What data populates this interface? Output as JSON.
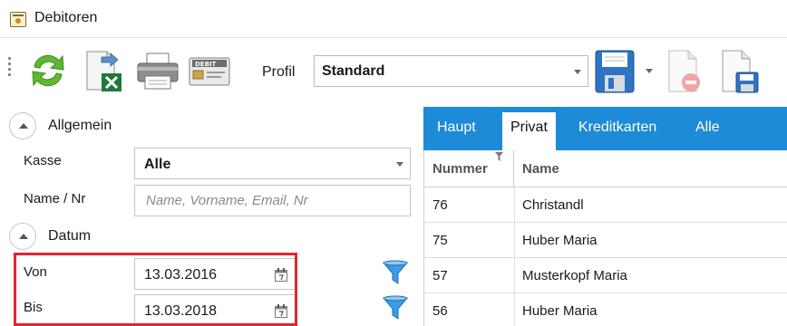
{
  "window": {
    "title": "Debitoren"
  },
  "toolbar": {
    "profil_label": "Profil",
    "profil_value": "Standard",
    "debit_icon_text": "DEBIT",
    "icons": [
      "refresh-icon",
      "excel-export-icon",
      "print-icon",
      "debit-card-icon",
      "save-icon",
      "delete-document-icon",
      "save-document-icon"
    ]
  },
  "allgemein": {
    "title": "Allgemein",
    "kasse_label": "Kasse",
    "kasse_value": "Alle",
    "name_label": "Name / Nr",
    "name_placeholder": "Name, Vorname, Email, Nr"
  },
  "datum": {
    "title": "Datum",
    "von_label": "Von",
    "von_value": "13.03.2016",
    "bis_label": "Bis",
    "bis_value": "13.03.2018"
  },
  "tabs": [
    {
      "label": "Haupt",
      "active": false
    },
    {
      "label": "Privat",
      "active": true
    },
    {
      "label": "Kreditkarten",
      "active": false
    },
    {
      "label": "Alle",
      "active": false
    }
  ],
  "grid": {
    "columns": [
      "Nummer",
      "Name"
    ],
    "rows": [
      {
        "nummer": "76",
        "name": "Christandl"
      },
      {
        "nummer": "75",
        "name": "Huber Maria"
      },
      {
        "nummer": "57",
        "name": "Musterkopf Maria"
      },
      {
        "nummer": "56",
        "name": "Huber Maria"
      }
    ]
  },
  "colors": {
    "accent": "#1e8bd8",
    "highlight": "#e3252f",
    "refresh_green": "#5db82e",
    "excel_green": "#1d7a3a",
    "filter_blue": "#3a9ee4"
  }
}
